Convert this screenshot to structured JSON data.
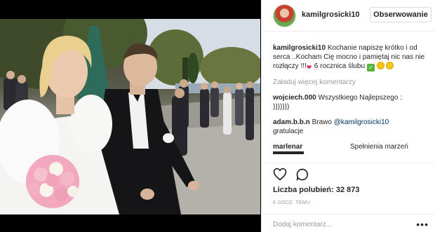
{
  "post": {
    "username": "kamilgrosicki10",
    "follow_label": "Obserwowanie",
    "caption_user": "kamilgrosicki10",
    "caption_text": "Kochanie napiszę krótko i od serca ..Kocham Cię mocno i pamiętaj nic nas nie rozłączy !!!",
    "caption_tail": "6 rocznica ślubu",
    "load_more": "Załaduj więcej komentarzy",
    "comments": [
      {
        "user": "wojciech.000",
        "text": "Wszystkiego Najlepszego :",
        "text2": ")))))))"
      },
      {
        "user": "adam.b.b.n",
        "pre": "Brawo ",
        "mention": "@kamilgrosicki10",
        "text2": "gratulacje"
      },
      {
        "user": "marlenar",
        "text": "Spełnienia marzeń"
      }
    ],
    "likes": "Liczba polubień: 32 873",
    "time": "6 GODZ. TEMU",
    "add_comment_placeholder": "Dodaj komentarz...",
    "more_label": "•••"
  },
  "icons": {
    "avatar": "avatar",
    "like": "heart-icon",
    "comment": "comment-bubble-icon",
    "more": "more-options-icon"
  }
}
